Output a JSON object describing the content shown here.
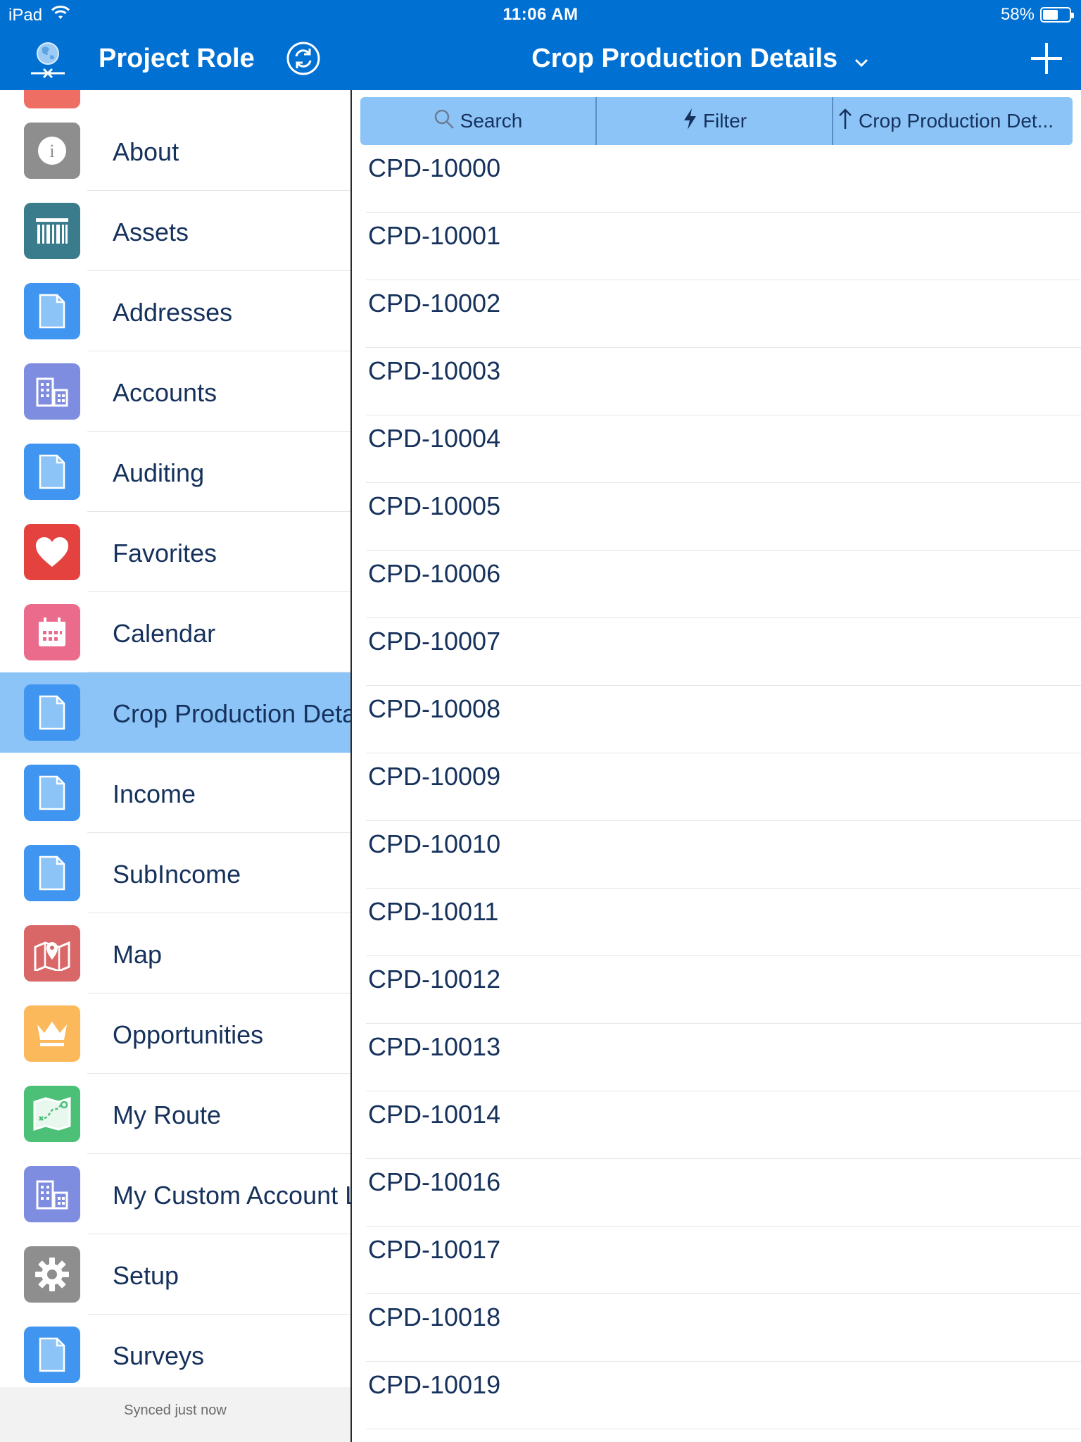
{
  "status_bar": {
    "device": "iPad",
    "time": "11:06 AM",
    "battery": "58%",
    "battery_level": 0.58
  },
  "nav": {
    "left_title": "Project Role",
    "center_title": "Crop Production Details"
  },
  "sidebar": {
    "items": [
      {
        "label": "About",
        "icon": "info-icon",
        "color": "#8e8e8e"
      },
      {
        "label": "Assets",
        "icon": "barcode-icon",
        "color": "#3a7b8c"
      },
      {
        "label": "Addresses",
        "icon": "document-icon",
        "color": "#3f95f0"
      },
      {
        "label": "Accounts",
        "icon": "building-icon",
        "color": "#7f8de1"
      },
      {
        "label": "Auditing",
        "icon": "document-icon",
        "color": "#3f95f0"
      },
      {
        "label": "Favorites",
        "icon": "heart-icon",
        "color": "#e4423f"
      },
      {
        "label": "Calendar",
        "icon": "calendar-icon",
        "color": "#eb6b8c"
      },
      {
        "label": "Crop Production Details",
        "icon": "document-icon",
        "color": "#3f95f0"
      },
      {
        "label": "Income",
        "icon": "document-icon",
        "color": "#3f95f0"
      },
      {
        "label": "SubIncome",
        "icon": "document-icon",
        "color": "#3f95f0"
      },
      {
        "label": "Map",
        "icon": "map-icon",
        "color": "#d96767"
      },
      {
        "label": "Opportunities",
        "icon": "crown-icon",
        "color": "#fcb95b"
      },
      {
        "label": "My Route",
        "icon": "route-icon",
        "color": "#4bc076"
      },
      {
        "label": "My Custom Account List",
        "icon": "building-icon",
        "color": "#7f8de1"
      },
      {
        "label": "Setup",
        "icon": "gear-icon",
        "color": "#8e8e8e"
      },
      {
        "label": "Surveys",
        "icon": "document-icon",
        "color": "#3f95f0"
      }
    ],
    "footer": "Synced just now"
  },
  "toolbar": {
    "search_label": "Search",
    "filter_label": "Filter",
    "sort_label": "Crop Production Det..."
  },
  "records": [
    "CPD-10000",
    "CPD-10001",
    "CPD-10002",
    "CPD-10003",
    "CPD-10004",
    "CPD-10005",
    "CPD-10006",
    "CPD-10007",
    "CPD-10008",
    "CPD-10009",
    "CPD-10010",
    "CPD-10011",
    "CPD-10012",
    "CPD-10013",
    "CPD-10014",
    "CPD-10016",
    "CPD-10017",
    "CPD-10018",
    "CPD-10019"
  ]
}
